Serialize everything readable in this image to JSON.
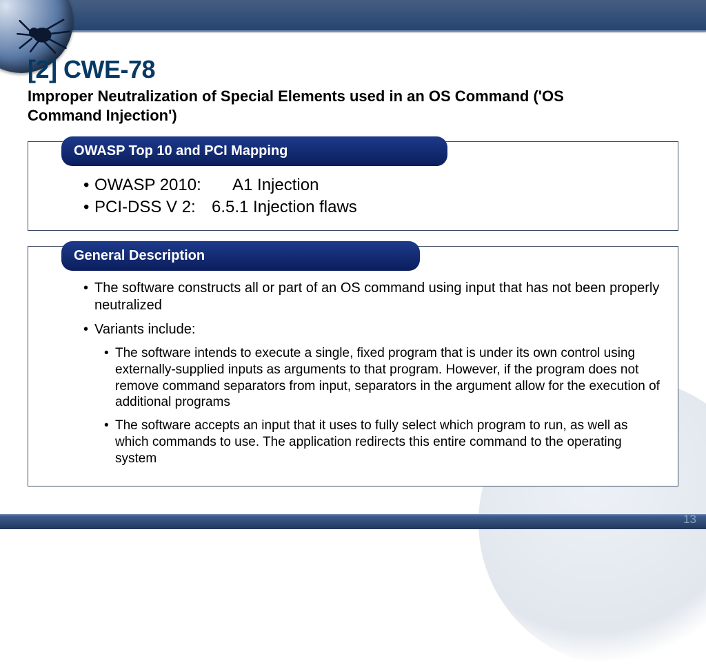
{
  "header": {
    "title": "[2] CWE-78",
    "subtitle": "Improper Neutralization of Special Elements used in an OS Command ('OS Command Injection')"
  },
  "boxes": {
    "mapping": {
      "pill": "OWASP Top 10 and PCI Mapping",
      "rows": [
        {
          "key": "OWASP 2010:",
          "val": "A1 Injection"
        },
        {
          "key": "PCI-DSS V 2:",
          "val": "6.5.1 Injection flaws"
        }
      ]
    },
    "desc": {
      "pill": "General Description",
      "items": [
        "The software constructs all or part of an OS command using input that has not been properly neutralized",
        "Variants include:"
      ],
      "sub": [
        "The software intends to execute a single, fixed program that is under its own control using externally-supplied inputs as arguments to that program. However, if the program does not remove command separators from input, separators in the argument allow for the execution of additional programs",
        "The software accepts an input that it uses to fully select which program to run, as well as which commands to use. The application redirects this entire command to the operating system"
      ]
    }
  },
  "pagenum": "13"
}
